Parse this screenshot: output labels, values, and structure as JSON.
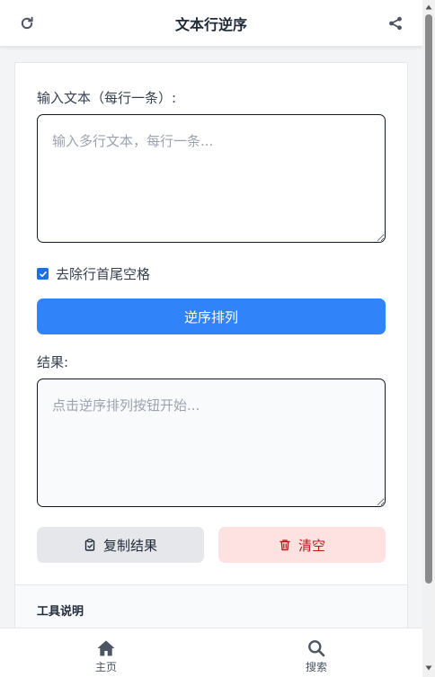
{
  "header": {
    "title": "文本行逆序",
    "refresh_icon": "refresh-icon",
    "share_icon": "share-icon"
  },
  "form": {
    "input_label": "输入文本（每行一条）:",
    "input_placeholder": "输入多行文本，每行一条...",
    "input_value": "",
    "trim_checkbox_label": "去除行首尾空格",
    "trim_checked": true,
    "reverse_button": "逆序排列",
    "result_label": "结果:",
    "result_placeholder": "点击逆序排列按钮开始...",
    "result_value": "",
    "copy_button": "复制结果",
    "clear_button": "清空"
  },
  "footer_section": {
    "title": "工具说明"
  },
  "bottom_nav": {
    "items": [
      {
        "label": "主页",
        "icon": "home-icon"
      },
      {
        "label": "搜索",
        "icon": "search-icon"
      }
    ]
  },
  "colors": {
    "primary": "#3183f9",
    "danger_bg": "#fee2e2",
    "danger_text": "#b91c1c",
    "neutral_btn": "#e5e7eb"
  }
}
